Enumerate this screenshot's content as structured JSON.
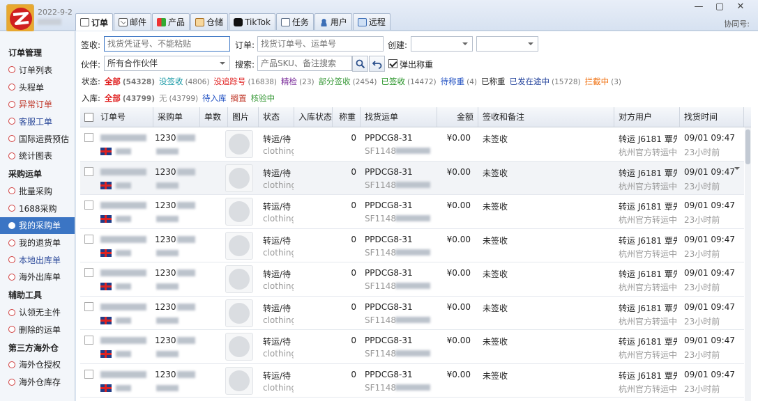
{
  "app": {
    "date": "2022-9-2",
    "agent_label": "协同号:",
    "window_controls": [
      "—",
      "▢",
      "✕"
    ]
  },
  "tabs": [
    {
      "label": "订单",
      "icon": "document-icon"
    },
    {
      "label": "邮件",
      "icon": "mail-icon"
    },
    {
      "label": "产品",
      "icon": "product-icon"
    },
    {
      "label": "仓储",
      "icon": "warehouse-icon"
    },
    {
      "label": "TikTok",
      "icon": "tiktok-icon"
    },
    {
      "label": "任务",
      "icon": "task-icon"
    },
    {
      "label": "用户",
      "icon": "user-icon"
    },
    {
      "label": "远程",
      "icon": "remote-icon"
    }
  ],
  "sidebar": {
    "sections": [
      {
        "title": "订单管理",
        "items": [
          {
            "label": "订单列表",
            "color": "#222222"
          },
          {
            "label": "头程单",
            "color": "#222222"
          },
          {
            "label": "异常订单",
            "color": "#c0392b"
          },
          {
            "label": "客服工单",
            "color": "#2c4a9a"
          },
          {
            "label": "国际运费预估",
            "color": "#222222"
          },
          {
            "label": "统计图表",
            "color": "#222222"
          }
        ]
      },
      {
        "title": "采购运单",
        "items": [
          {
            "label": "批量采购",
            "color": "#222222"
          },
          {
            "label": "1688采购",
            "color": "#222222"
          },
          {
            "label": "我的采购单",
            "color": "#ffffff",
            "active": true
          },
          {
            "label": "我的退货单",
            "color": "#222222"
          },
          {
            "label": "本地出库单",
            "color": "#2c4a9a"
          },
          {
            "label": "海外出库单",
            "color": "#222222"
          }
        ]
      },
      {
        "title": "辅助工具",
        "items": [
          {
            "label": "认领无主件",
            "color": "#222222"
          },
          {
            "label": "删除的运单",
            "color": "#222222"
          }
        ]
      },
      {
        "title": "第三方海外仓",
        "items": [
          {
            "label": "海外仓授权",
            "color": "#222222"
          },
          {
            "label": "海外仓库存",
            "color": "#222222"
          }
        ]
      }
    ]
  },
  "filters": {
    "sign_label": "签收:",
    "sign_placeholder": "找货凭证号、不能粘贴",
    "order_label": "订单:",
    "order_placeholder": "找货订单号、运单号",
    "created_label": "创建:",
    "partner_label": "伙伴:",
    "partner_value": "所有合作伙伴",
    "search_label": "搜索:",
    "search_placeholder": "产品SKU、备注搜索",
    "popup_weigh_label": "弹出称重"
  },
  "status_row": {
    "label": "状态:",
    "items": [
      {
        "label": "全部",
        "count": "(54328)",
        "color": "#e02020",
        "bold": true
      },
      {
        "label": "没签收",
        "count": "(4806)",
        "color": "#1a9aa6"
      },
      {
        "label": "没追踪号",
        "count": "(16838)",
        "color": "#e02020"
      },
      {
        "label": "精检",
        "count": "(23)",
        "color": "#7a2b9a"
      },
      {
        "label": "部分签收",
        "count": "(2454)",
        "color": "#3a9a3a"
      },
      {
        "label": "已签收",
        "count": "(14472)",
        "color": "#1f8f1f"
      },
      {
        "label": "待称重",
        "count": "(4)",
        "color": "#1f4fc2"
      },
      {
        "label": "已称重",
        "count": "",
        "color": "#222222"
      },
      {
        "label": "已发在途中",
        "count": "(15728)",
        "color": "#1f3f9a"
      },
      {
        "label": "拦截中",
        "count": "(3)",
        "color": "#f07010"
      }
    ]
  },
  "stock_row": {
    "label": "入库:",
    "items": [
      {
        "label": "全部",
        "count": "(43799)",
        "color": "#e02020",
        "bold": true
      },
      {
        "label": "无",
        "count": "(43799)",
        "color": "#999999"
      },
      {
        "label": "待入库",
        "count": "",
        "color": "#1f4fc2"
      },
      {
        "label": "搁置",
        "count": "",
        "color": "#c0392b"
      },
      {
        "label": "核验中",
        "count": "",
        "color": "#3a9a3a"
      }
    ]
  },
  "table": {
    "columns": [
      "订单号",
      "采购单",
      "单数",
      "图片",
      "状态",
      "入库状态",
      "称重",
      "找货运单",
      "金额",
      "签收和备注",
      "对方用户",
      "找货时间"
    ],
    "rows": [
      {
        "purchase": "1230",
        "status": "转运/待",
        "category": "clothing",
        "weight": "0",
        "waybill": "PPDCG8-31",
        "waybill2": "SF1148",
        "amount": "¥0.00",
        "note": "未签收",
        "user": "转运 J6181 覃先",
        "user2": "杭州官方转运中",
        "time": "09/01 09:47",
        "ago": "23小时前"
      },
      {
        "purchase": "1230",
        "status": "转运/待",
        "category": "clothing",
        "weight": "0",
        "waybill": "PPDCG8-31",
        "waybill2": "SF1148",
        "amount": "¥0.00",
        "note": "未签收",
        "user": "转运 J6181 覃先",
        "user2": "杭州官方转运中",
        "time": "09/01 09:47",
        "ago": "23小时前"
      },
      {
        "purchase": "1230",
        "status": "转运/待",
        "category": "clothing",
        "weight": "0",
        "waybill": "PPDCG8-31",
        "waybill2": "SF1148",
        "amount": "¥0.00",
        "note": "未签收",
        "user": "转运 J6181 覃先",
        "user2": "杭州官方转运中",
        "time": "09/01 09:47",
        "ago": "23小时前"
      },
      {
        "purchase": "1230",
        "status": "转运/待",
        "category": "clothing",
        "weight": "0",
        "waybill": "PPDCG8-31",
        "waybill2": "SF1148",
        "amount": "¥0.00",
        "note": "未签收",
        "user": "转运 J6181 覃先",
        "user2": "杭州官方转运中",
        "time": "09/01 09:47",
        "ago": "23小时前"
      },
      {
        "purchase": "1230",
        "status": "转运/待",
        "category": "clothing",
        "weight": "0",
        "waybill": "PPDCG8-31",
        "waybill2": "SF1148",
        "amount": "¥0.00",
        "note": "未签收",
        "user": "转运 J6181 覃先",
        "user2": "杭州官方转运中",
        "time": "09/01 09:47",
        "ago": "23小时前"
      },
      {
        "purchase": "1230",
        "status": "转运/待",
        "category": "clothing",
        "weight": "0",
        "waybill": "PPDCG8-31",
        "waybill2": "SF1148",
        "amount": "¥0.00",
        "note": "未签收",
        "user": "转运 J6181 覃先",
        "user2": "杭州官方转运中",
        "time": "09/01 09:47",
        "ago": "23小时前"
      },
      {
        "purchase": "1230",
        "status": "转运/待",
        "category": "clothing",
        "weight": "0",
        "waybill": "PPDCG8-31",
        "waybill2": "SF1148",
        "amount": "¥0.00",
        "note": "未签收",
        "user": "转运 J6181 覃先",
        "user2": "杭州官方转运中",
        "time": "09/01 09:47",
        "ago": "23小时前"
      },
      {
        "purchase": "1230",
        "status": "转运/待",
        "category": "clothing",
        "weight": "0",
        "waybill": "PPDCG8-31",
        "waybill2": "SF1148",
        "amount": "¥0.00",
        "note": "未签收",
        "user": "转运 J6181 覃先",
        "user2": "杭州官方转运中",
        "time": "09/01 09:47",
        "ago": "23小时前"
      }
    ]
  }
}
